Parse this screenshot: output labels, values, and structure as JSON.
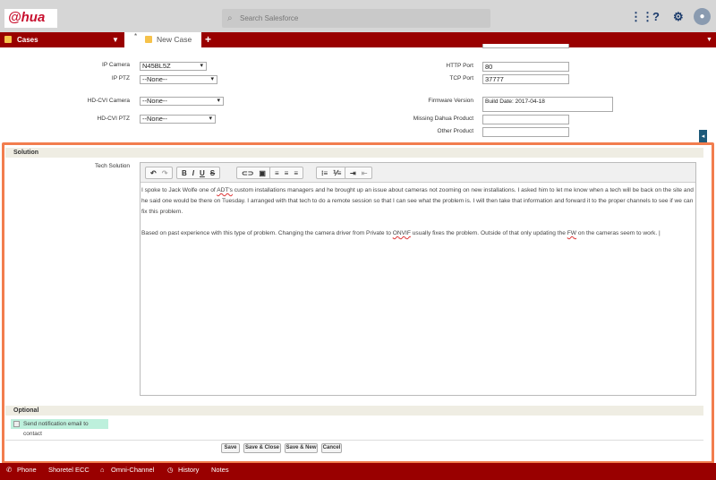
{
  "header": {
    "logo": "alhua",
    "search_placeholder": "Search Salesforce",
    "icons": [
      "app-launcher-icon",
      "help-icon",
      "gear-icon",
      "avatar-icon"
    ]
  },
  "nav": {
    "app": "Cases",
    "tab_modified": "*",
    "tab": "New Case"
  },
  "fields": {
    "ip_camera": {
      "label": "IP Camera",
      "value": "N45BL5Z"
    },
    "ip_ptz": {
      "label": "IP PTZ",
      "value": "--None--"
    },
    "hdcvi_camera": {
      "label": "HD-CVI Camera",
      "value": "--None--"
    },
    "hdcvi_ptz": {
      "label": "HD-CVI PTZ",
      "value": "--None--"
    },
    "http_port": {
      "label": "HTTP Port",
      "value": "80"
    },
    "tcp_port": {
      "label": "TCP Port",
      "value": "37777"
    },
    "firmware": {
      "label": "Firmware Version",
      "value": "Build Date: 2017-04-18"
    },
    "missing": {
      "label": "Missing Dahua Product",
      "value": ""
    },
    "other": {
      "label": "Other Product",
      "value": ""
    }
  },
  "solution": {
    "header": "Solution",
    "label": "Tech Solution",
    "p1a": "I spoke to Jack Wolfe one of ",
    "p1u": "ADT's",
    "p1b": " custom installations managers and he brought up an issue about cameras not zooming on new installations. I asked him to let me know when a tech will be back on the site and he said one would be there on Tuesday. I arranged with that tech to do a remote session so that I can see what the problem is. I will then take that information and forward it to the proper channels to see if we can fix this problem.",
    "p2a": "Based on past experience with this type of problem. Changing the camera driver from Private to ",
    "p2u": "ONVIF",
    "p2b": " usually fixes the problem. Outside of that only updating the ",
    "p2u2": "FW",
    "p2c": " on the cameras seem to work."
  },
  "optional": {
    "header": "Optional",
    "checkbox": "Send notification email to contact",
    "checked": false
  },
  "buttons": {
    "save": "Save",
    "save_close": "Save & Close",
    "save_new": "Save & New",
    "cancel": "Cancel"
  },
  "footer": {
    "phone": "Phone",
    "shoretel": "Shoretel ECC",
    "omni": "Omni-Channel",
    "history": "History",
    "notes": "Notes"
  },
  "colors": {
    "brand_red": "#990000",
    "highlight": "#f27d4e"
  }
}
